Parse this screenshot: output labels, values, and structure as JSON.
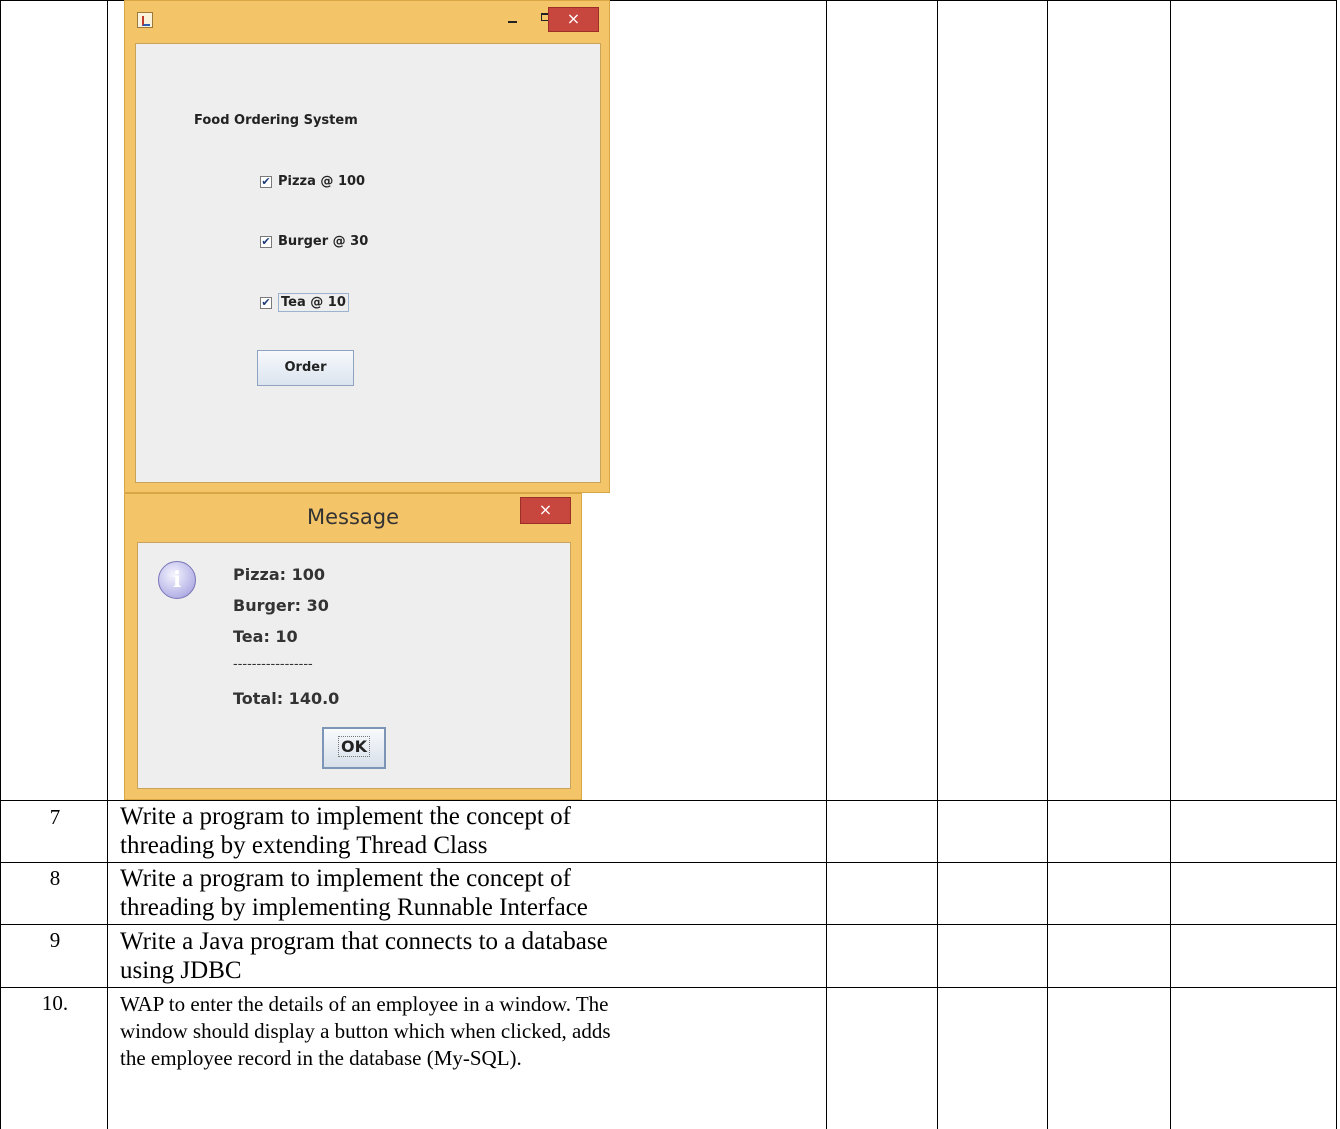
{
  "food_window": {
    "title": "Food Ordering System",
    "close_glyph": "×",
    "items": [
      {
        "label": "Pizza @ 100",
        "checked": true,
        "check_glyph": "✔"
      },
      {
        "label": "Burger @ 30",
        "checked": true,
        "check_glyph": "✔"
      },
      {
        "label": "Tea @ 10",
        "checked": true,
        "check_glyph": "✔"
      }
    ],
    "order_button": "Order"
  },
  "message_dialog": {
    "title": "Message",
    "close_glyph": "×",
    "icon_glyph": "i",
    "lines": [
      "Pizza: 100",
      "Burger: 30",
      "Tea: 10",
      "-----------------",
      "Total: 140.0"
    ],
    "ok_button": "OK"
  },
  "table_rows": [
    {
      "number": "7",
      "task_lines": [
        "Write a program to implement the concept of",
        "threading by extending Thread Class"
      ]
    },
    {
      "number": "8",
      "task_lines": [
        "Write a program to implement the concept of",
        "threading by implementing Runnable Interface"
      ]
    },
    {
      "number": "9",
      "task_lines": [
        "Write a Java program that connects to a database",
        "using JDBC"
      ]
    },
    {
      "number": "10.",
      "task_lines": [
        "WAP to enter the details of an employee in a window. The",
        "window should display a button which when clicked, adds",
        "the employee record in the database (My-SQL)."
      ]
    }
  ]
}
